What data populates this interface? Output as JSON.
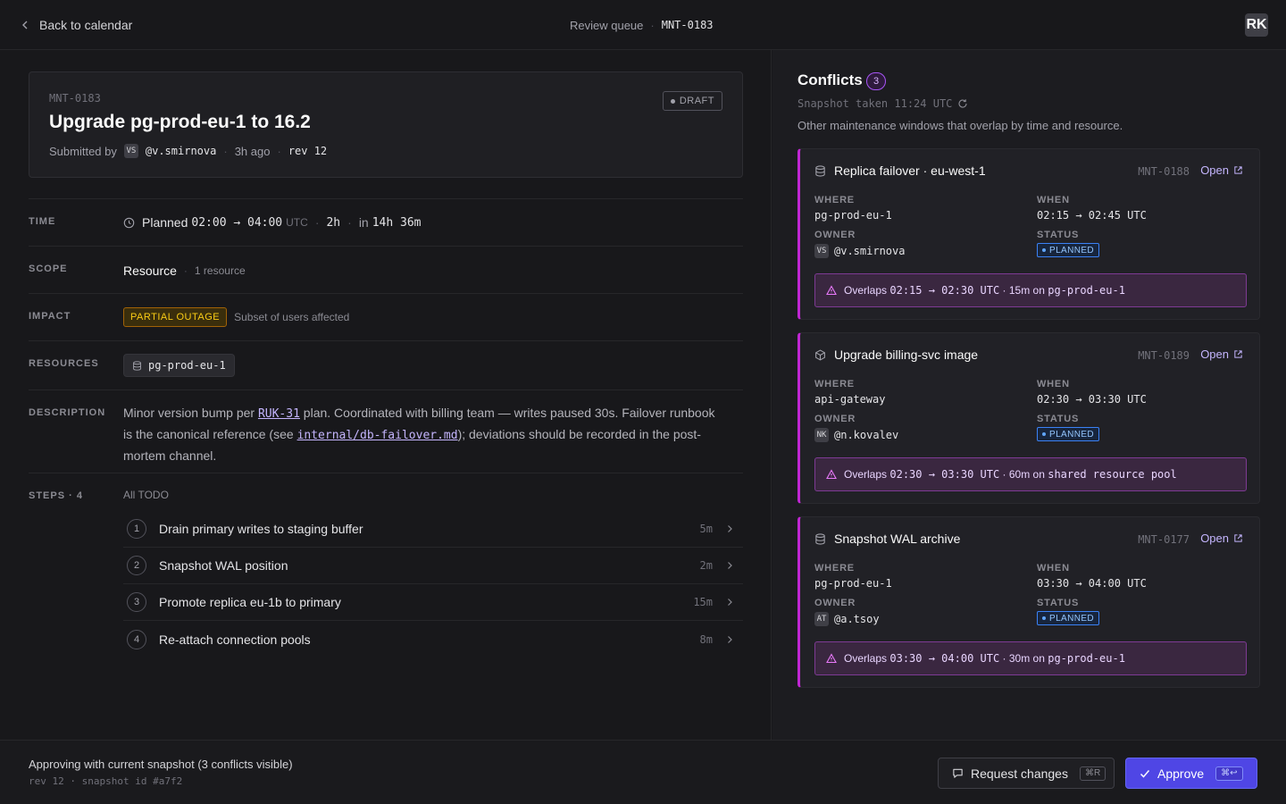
{
  "topbar": {
    "back_label": "Back to calendar",
    "breadcrumb_queue": "Review queue",
    "breadcrumb_sep": "·",
    "breadcrumb_id": "MNT-0183",
    "user_initials": "RK"
  },
  "header": {
    "id": "MNT-0183",
    "title": "Upgrade pg-prod-eu-1 to 16.2",
    "submitted_by_label": "Submitted by",
    "submitter_initials": "VS",
    "submitter": "@v.smirnova",
    "age": "3h ago",
    "rev": "rev 12",
    "status": "DRAFT"
  },
  "fields": {
    "time": {
      "label": "TIME",
      "planned_label": "Planned",
      "range": "02:00 → 04:00",
      "tz": "UTC",
      "duration": "2h",
      "in_label": "in",
      "countdown": "14h 36m"
    },
    "scope": {
      "label": "SCOPE",
      "value": "Resource",
      "count": "1 resource"
    },
    "impact": {
      "label": "IMPACT",
      "badge": "PARTIAL OUTAGE",
      "note": "Subset of users affected"
    },
    "resources": {
      "label": "RESOURCES",
      "items": [
        "pg-prod-eu-1"
      ]
    },
    "description": {
      "label": "DESCRIPTION",
      "part1": "Minor version bump per ",
      "link1": "RUK-31",
      "part2": " plan. Coordinated with billing team — writes paused 30s. Failover runbook is the canonical reference (see ",
      "link2": "internal/db-failover.md",
      "part3": "); deviations should be recorded in the post-mortem channel."
    },
    "steps": {
      "label": "STEPS · 4",
      "summary": "All TODO",
      "items": [
        {
          "num": "1",
          "label": "Drain primary writes to staging buffer",
          "duration": "5m"
        },
        {
          "num": "2",
          "label": "Snapshot WAL position",
          "duration": "2m"
        },
        {
          "num": "3",
          "label": "Promote replica eu-1b to primary",
          "duration": "15m"
        },
        {
          "num": "4",
          "label": "Re-attach connection pools",
          "duration": "8m"
        }
      ]
    }
  },
  "conflicts": {
    "title": "Conflicts",
    "count": "3",
    "snapshot": "Snapshot taken 11:24 UTC",
    "subtitle": "Other maintenance windows that overlap by time and resource.",
    "labels": {
      "where": "WHERE",
      "when": "WHEN",
      "owner": "OWNER",
      "status": "STATUS",
      "open": "Open"
    },
    "items": [
      {
        "icon": "database-icon",
        "title": "Replica failover · eu-west-1",
        "id": "MNT-0188",
        "where": "pg-prod-eu-1",
        "when": "02:15 → 02:45 UTC",
        "owner_initials": "VS",
        "owner": "@v.smirnova",
        "status": "PLANNED",
        "overlap_prefix": "Overlaps",
        "overlap_range": "02:15 → 02:30 UTC",
        "overlap_mid": " · 15m on ",
        "overlap_target": "pg-prod-eu-1"
      },
      {
        "icon": "package-icon",
        "title": "Upgrade billing-svc image",
        "id": "MNT-0189",
        "where": "api-gateway",
        "when": "02:30 → 03:30 UTC",
        "owner_initials": "NK",
        "owner": "@n.kovalev",
        "status": "PLANNED",
        "overlap_prefix": "Overlaps",
        "overlap_range": "02:30 → 03:30 UTC",
        "overlap_mid": " · 60m on ",
        "overlap_target": "shared resource pool"
      },
      {
        "icon": "database-icon",
        "title": "Snapshot WAL archive",
        "id": "MNT-0177",
        "where": "pg-prod-eu-1",
        "when": "03:30 → 04:00 UTC",
        "owner_initials": "AT",
        "owner": "@a.tsoy",
        "status": "PLANNED",
        "overlap_prefix": "Overlaps",
        "overlap_range": "03:30 → 04:00 UTC",
        "overlap_mid": " · 30m on ",
        "overlap_target": "pg-prod-eu-1"
      }
    ]
  },
  "footer": {
    "message": "Approving with current snapshot (3 conflicts visible)",
    "meta": "rev 12 · snapshot id #a7f2",
    "request_label": "Request changes",
    "request_shortcut": "⌘R",
    "approve_label": "Approve",
    "approve_shortcut": "⌘↩"
  },
  "colors": {
    "accent": "#4f46e5",
    "conflict": "#c026d3",
    "warning": "#facc15",
    "planned": "#3b82f6"
  }
}
